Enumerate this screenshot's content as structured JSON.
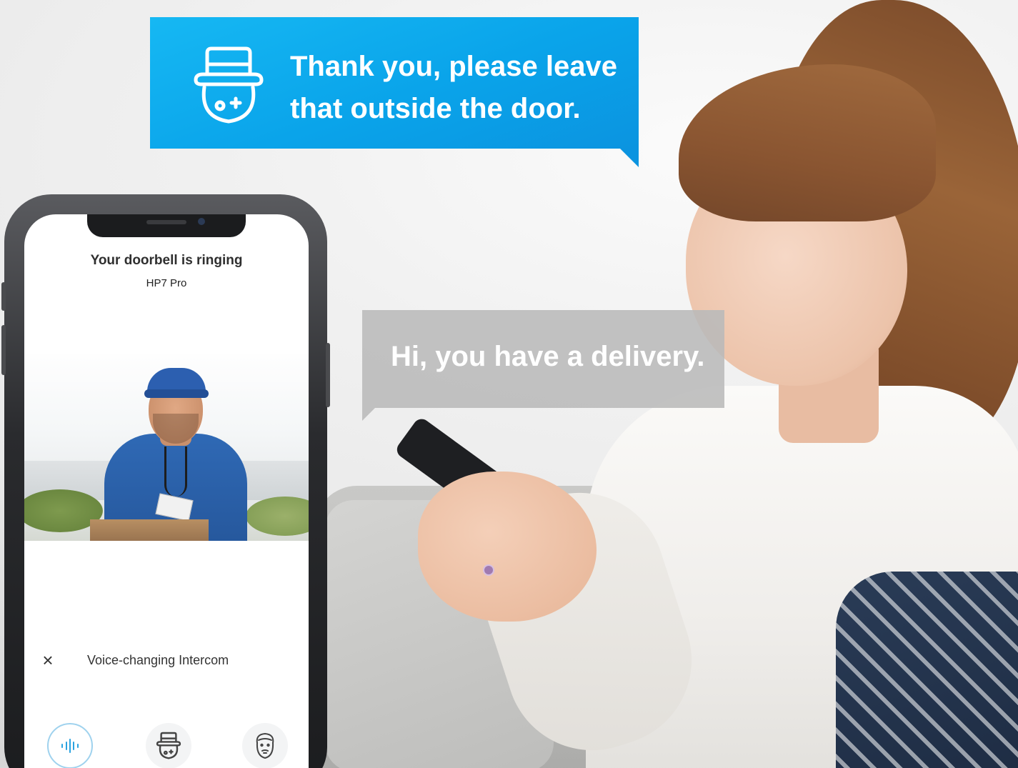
{
  "bubbles": {
    "reply": "Thank you, please leave that outside the door.",
    "visitor": "Hi, you have a delivery."
  },
  "phone": {
    "call_title": "Your doorbell is ringing",
    "device_name": "HP7 Pro",
    "close_icon": "×",
    "intercom_label": "Voice-changing Intercom",
    "voice_options": [
      "original-voice-icon",
      "hat-character-icon",
      "bearded-man-icon"
    ]
  },
  "colors": {
    "accent_blue": "#0aa4ea",
    "gray_bubble": "#b9b9b9"
  }
}
